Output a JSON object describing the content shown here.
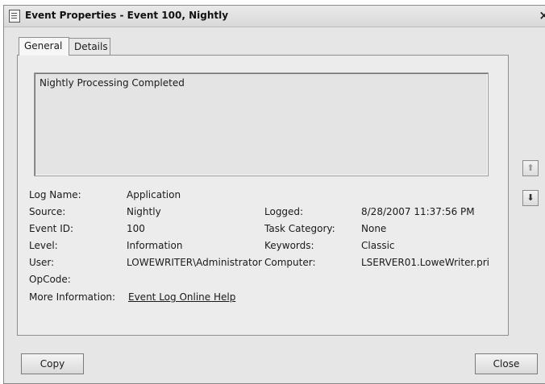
{
  "window": {
    "title": "Event Properties - Event 100, Nightly",
    "close_glyph": "×"
  },
  "tabs": [
    {
      "label": "General",
      "active": true
    },
    {
      "label": "Details",
      "active": false
    }
  ],
  "description": "Nightly Processing Completed",
  "fields": {
    "log_name": {
      "label": "Log Name:",
      "value": "Application"
    },
    "source": {
      "label": "Source:",
      "value": "Nightly"
    },
    "event_id": {
      "label": "Event ID:",
      "value": "100"
    },
    "level": {
      "label": "Level:",
      "value": "Information"
    },
    "user": {
      "label": "User:",
      "value": "LOWEWRITER\\Administrator"
    },
    "opcode": {
      "label": "OpCode:",
      "value": ""
    },
    "more_info": {
      "label": "More Information:",
      "value": "Event Log Online Help"
    },
    "logged": {
      "label": "Logged:",
      "value": "8/28/2007 11:37:56 PM"
    },
    "task_category": {
      "label": "Task Category:",
      "value": "None"
    },
    "keywords": {
      "label": "Keywords:",
      "value": "Classic"
    },
    "computer": {
      "label": "Computer:",
      "value": "LSERVER01.LoweWriter.pri"
    }
  },
  "nav": {
    "up_icon": "arrow-up-icon",
    "down_icon": "arrow-down-icon",
    "up_glyph": "⬆",
    "down_glyph": "⬇"
  },
  "buttons": {
    "copy": "Copy",
    "close": "Close"
  }
}
